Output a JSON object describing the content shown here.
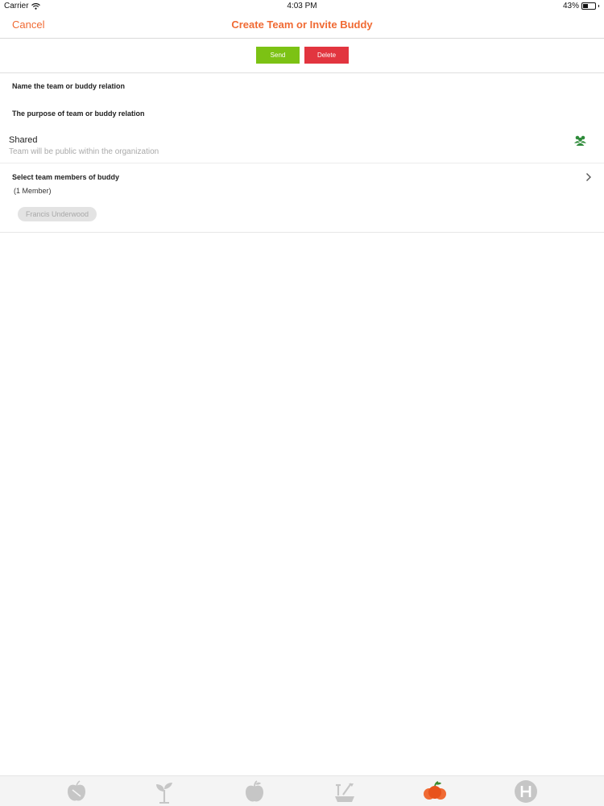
{
  "status_bar": {
    "carrier": "Carrier",
    "time": "4:03 PM",
    "battery": "43%",
    "battery_level": 0.43
  },
  "nav": {
    "cancel": "Cancel",
    "title": "Create Team or Invite Buddy"
  },
  "actions": {
    "send": "Send",
    "delete": "Delete"
  },
  "form": {
    "name_label": "Name the team or buddy relation",
    "purpose_label": "The purpose of team or buddy relation",
    "shared_title": "Shared",
    "shared_subtitle": "Team will be public within the organization",
    "members_label": "Select team members of buddy",
    "members_count": "(1 Member)",
    "members": [
      "Francis Underwood"
    ]
  },
  "tabbar": {
    "items": [
      "apple-outline-icon",
      "sprout-icon",
      "apple-icon",
      "tools-icon",
      "team-apples-icon",
      "h-icon"
    ],
    "active_index": 4
  },
  "colors": {
    "accent": "#f06a33",
    "send": "#7cc214",
    "delete": "#e2353f",
    "shared_icon": "#2e8b3a",
    "tab_inactive": "#c6c6c6"
  }
}
